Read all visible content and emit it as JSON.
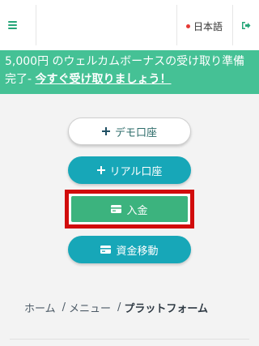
{
  "header": {
    "menu_icon": "hamburger-menu-icon",
    "language": "日本語",
    "logout_icon": "logout-icon",
    "colors": {
      "accent": "#26a679",
      "flag": "#e53935"
    }
  },
  "banner": {
    "text": "5,000円 のウェルカムボーナスの受け取り準備完了- ",
    "link": "今すぐ受け取りましょう！",
    "background": "#45c195"
  },
  "buttons": {
    "demo": {
      "label": "デモ口座",
      "icon": "plus-icon"
    },
    "real": {
      "label": "リアル口座",
      "icon": "plus-icon"
    },
    "deposit": {
      "label": "入金",
      "icon": "card-icon"
    },
    "transfer": {
      "label": "資金移動",
      "icon": "card-icon"
    }
  },
  "breadcrumb": {
    "items": [
      "ホーム",
      "メニュー"
    ],
    "current": "プラットフォーム",
    "separator": "/"
  }
}
